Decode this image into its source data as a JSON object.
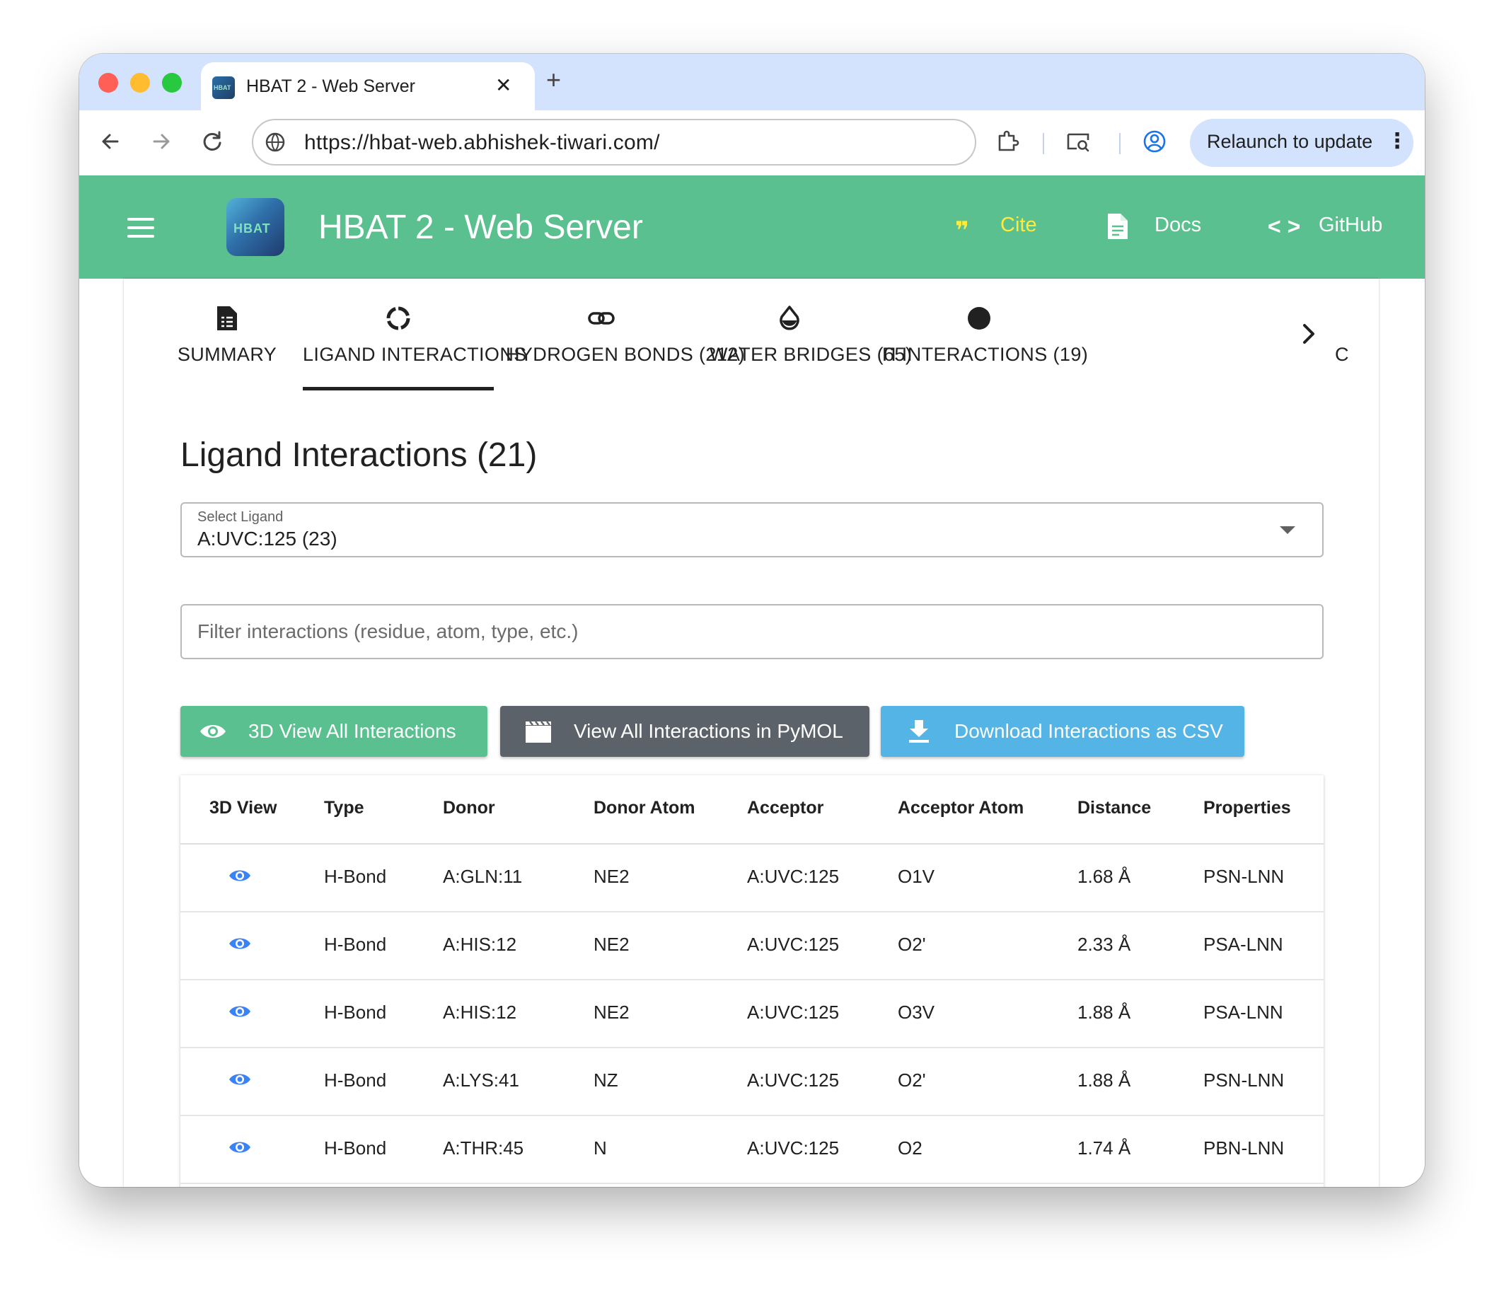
{
  "browser": {
    "tab_title": "HBAT 2 - Web Server",
    "url": "https://hbat-web.abhishek-tiwari.com/",
    "relaunch_label": "Relaunch to update"
  },
  "appbar": {
    "logo_text": "HBAT",
    "title": "HBAT 2 - Web Server",
    "links": {
      "cite": "Cite",
      "docs": "Docs",
      "github": "GitHub"
    }
  },
  "tabs": [
    {
      "label": "SUMMARY",
      "icon": "summary-doc-icon"
    },
    {
      "label": "LIGAND INTERACTIONS",
      "icon": "ring-icon",
      "active": true
    },
    {
      "label": "HYDROGEN BONDS (212)",
      "icon": "link-icon"
    },
    {
      "label": "WATER BRIDGES (65)",
      "icon": "water-drop-icon"
    },
    {
      "label": "Π INTERACTIONS (19)",
      "icon": "filled-circle-icon"
    }
  ],
  "tab_cutoff_text": "C",
  "section": {
    "title": "Ligand Interactions (21)",
    "select_label": "Select Ligand",
    "select_value": "A:UVC:125 (23)",
    "filter_placeholder": "Filter interactions (residue, atom, type, etc.)"
  },
  "buttons": {
    "view3d": "3D View All Interactions",
    "pymol": "View All Interactions in PyMOL",
    "csv": "Download Interactions as CSV"
  },
  "table": {
    "headers": [
      "3D View",
      "Type",
      "Donor",
      "Donor Atom",
      "Acceptor",
      "Acceptor Atom",
      "Distance",
      "Properties"
    ],
    "rows": [
      {
        "type": "H-Bond",
        "donor": "A:GLN:11",
        "donor_atom": "NE2",
        "acceptor": "A:UVC:125",
        "acceptor_atom": "O1V",
        "distance": "1.68 Å",
        "properties": "PSN-LNN"
      },
      {
        "type": "H-Bond",
        "donor": "A:HIS:12",
        "donor_atom": "NE2",
        "acceptor": "A:UVC:125",
        "acceptor_atom": "O2'",
        "distance": "2.33 Å",
        "properties": "PSA-LNN"
      },
      {
        "type": "H-Bond",
        "donor": "A:HIS:12",
        "donor_atom": "NE2",
        "acceptor": "A:UVC:125",
        "acceptor_atom": "O3V",
        "distance": "1.88 Å",
        "properties": "PSA-LNN"
      },
      {
        "type": "H-Bond",
        "donor": "A:LYS:41",
        "donor_atom": "NZ",
        "acceptor": "A:UVC:125",
        "acceptor_atom": "O2'",
        "distance": "1.88 Å",
        "properties": "PSN-LNN"
      },
      {
        "type": "H-Bond",
        "donor": "A:THR:45",
        "donor_atom": "N",
        "acceptor": "A:UVC:125",
        "acceptor_atom": "O2",
        "distance": "1.74 Å",
        "properties": "PBN-LNN"
      }
    ]
  },
  "colors": {
    "appbar": "#5ac08f",
    "cite": "#ffeb3b",
    "btn_green": "#5ac08f",
    "btn_grey": "#5c6269",
    "btn_blue": "#54b4e6",
    "eye_icon": "#3b82f6",
    "browser_chrome": "#d3e3fd"
  }
}
